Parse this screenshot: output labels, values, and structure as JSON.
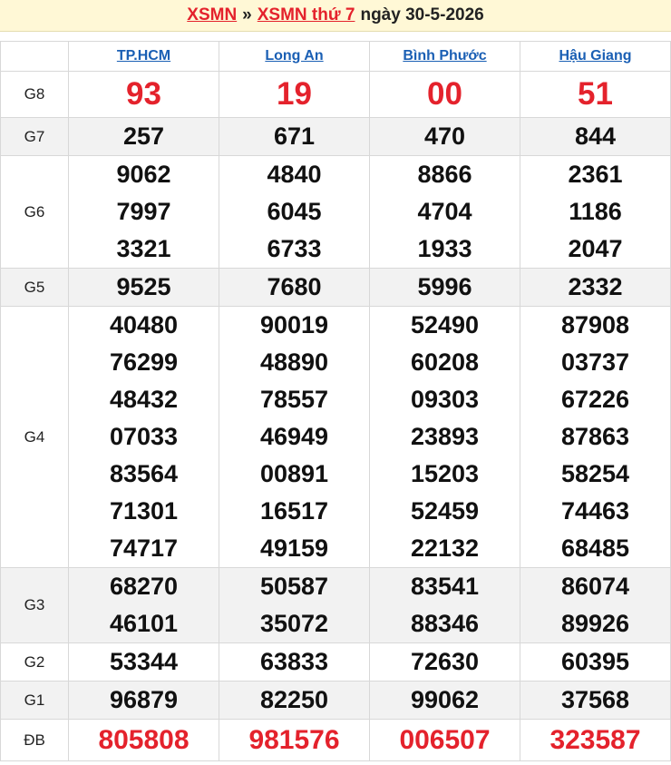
{
  "header": {
    "brand": "XSMN",
    "separator": "»",
    "link": "XSMN thứ 7",
    "date": "ngày 30-5-2026"
  },
  "provinces": [
    "TP.HCM",
    "Long An",
    "Bình Phước",
    "Hậu Giang"
  ],
  "prizes": [
    {
      "id": "g8",
      "label": "G8",
      "results": [
        [
          "93"
        ],
        [
          "19"
        ],
        [
          "00"
        ],
        [
          "51"
        ]
      ]
    },
    {
      "id": "g7",
      "label": "G7",
      "results": [
        [
          "257"
        ],
        [
          "671"
        ],
        [
          "470"
        ],
        [
          "844"
        ]
      ]
    },
    {
      "id": "g6",
      "label": "G6",
      "results": [
        [
          "9062",
          "7997",
          "3321"
        ],
        [
          "4840",
          "6045",
          "6733"
        ],
        [
          "8866",
          "4704",
          "1933"
        ],
        [
          "2361",
          "1186",
          "2047"
        ]
      ]
    },
    {
      "id": "g5",
      "label": "G5",
      "results": [
        [
          "9525"
        ],
        [
          "7680"
        ],
        [
          "5996"
        ],
        [
          "2332"
        ]
      ]
    },
    {
      "id": "g4",
      "label": "G4",
      "results": [
        [
          "40480",
          "76299",
          "48432",
          "07033",
          "83564",
          "71301",
          "74717"
        ],
        [
          "90019",
          "48890",
          "78557",
          "46949",
          "00891",
          "16517",
          "49159"
        ],
        [
          "52490",
          "60208",
          "09303",
          "23893",
          "15203",
          "52459",
          "22132"
        ],
        [
          "87908",
          "03737",
          "67226",
          "87863",
          "58254",
          "74463",
          "68485"
        ]
      ]
    },
    {
      "id": "g3",
      "label": "G3",
      "results": [
        [
          "68270",
          "46101"
        ],
        [
          "50587",
          "35072"
        ],
        [
          "83541",
          "88346"
        ],
        [
          "86074",
          "89926"
        ]
      ]
    },
    {
      "id": "g2",
      "label": "G2",
      "results": [
        [
          "53344"
        ],
        [
          "63833"
        ],
        [
          "72630"
        ],
        [
          "60395"
        ]
      ]
    },
    {
      "id": "g1",
      "label": "G1",
      "results": [
        [
          "96879"
        ],
        [
          "82250"
        ],
        [
          "99062"
        ],
        [
          "37568"
        ]
      ]
    },
    {
      "id": "db",
      "label": "ĐB",
      "results": [
        [
          "805808"
        ],
        [
          "981576"
        ],
        [
          "006507"
        ],
        [
          "323587"
        ]
      ]
    }
  ],
  "colors": {
    "accent": "#e4222c",
    "link": "#1a5fb4",
    "title_bg": "#fff8d6",
    "alt_row": "#f2f2f2"
  }
}
